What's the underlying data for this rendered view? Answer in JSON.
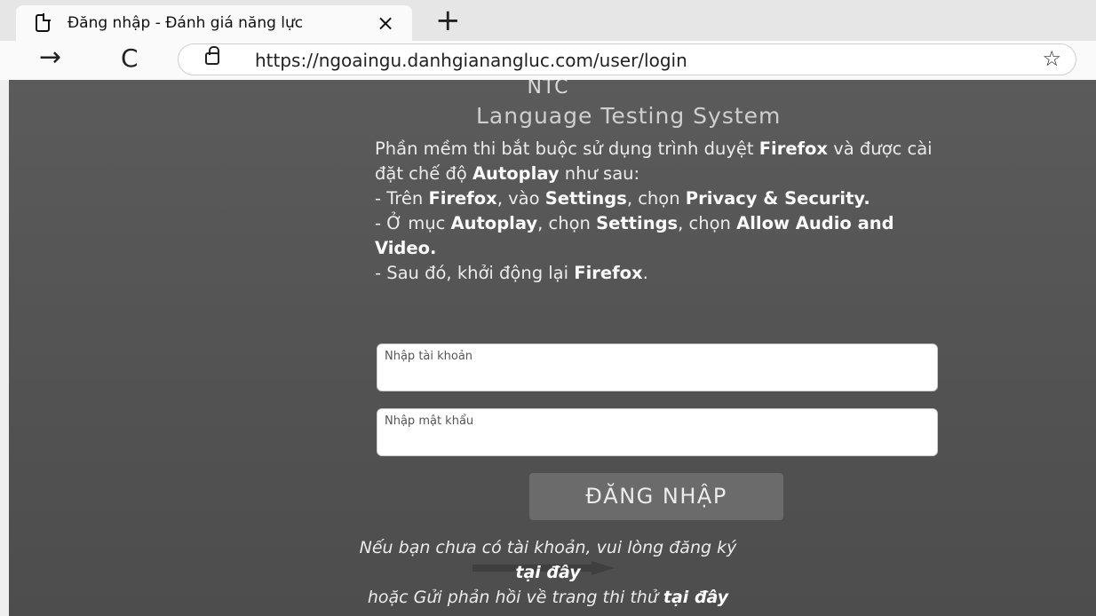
{
  "browser": {
    "tab_title": "Đăng nhập - Đánh giá năng lực",
    "tab_close": "×",
    "new_tab": "+",
    "back": "→",
    "reload": "C",
    "url": "https://ngoaingu.danhgianangluc.com/user/login",
    "favorites": "☆"
  },
  "header": {
    "brand": "NTC",
    "subtitle": "Language Testing System"
  },
  "notice": {
    "p1_a": "Phần mềm thi bắt buộc sử dụng trình duyệt ",
    "p1_b": "Firefox",
    "p1_c": " và được cài đặt chế độ ",
    "p1_d": "Autoplay",
    "p1_e": " như sau:",
    "p2_a": "- Trên ",
    "p2_b": "Firefox",
    "p2_c": ", vào ",
    "p2_d": "Settings",
    "p2_e": ", chọn ",
    "p2_f": "Privacy & Security.",
    "p3_a": "- Ở mục ",
    "p3_b": "Autoplay",
    "p3_c": ", chọn ",
    "p3_d": "Settings",
    "p3_e": ", chọn ",
    "p3_f": "Allow Audio and Video.",
    "p4_a": "- Sau đó, khởi động lại ",
    "p4_b": "Firefox",
    "p4_c": "."
  },
  "form": {
    "username_placeholder": "Nhập tài khoản",
    "password_placeholder": "Nhập mật khẩu",
    "login_label": "ĐĂNG NHẬP"
  },
  "footer": {
    "register_text": "Nếu bạn chưa có tài khoản, vui lòng đăng ký",
    "register_link": "tại đây",
    "feedback_text": "hoặc Gửi phản hồi về trang thi thử ",
    "feedback_link": "tại đây"
  }
}
